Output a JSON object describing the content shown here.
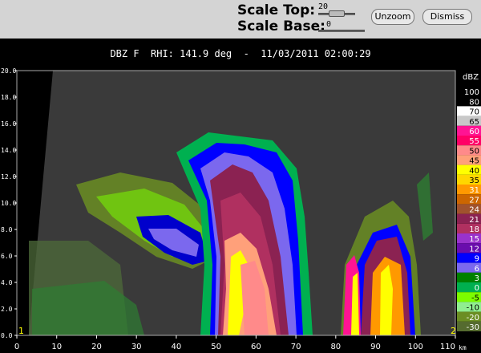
{
  "toolbar": {
    "scale_top_label": "Scale Top:",
    "scale_top_value": "20",
    "scale_base_label": "Scale Base:",
    "scale_base_value": "0",
    "unzoom_label": "Unzoom",
    "dismiss_label": "Dismiss"
  },
  "plot_title": "DBZ F  RHI: 141.9 deg  -  11/03/2011 02:00:29",
  "chart_data": {
    "type": "heatmap",
    "field": "DBZ F",
    "rhi_azimuth": "141.9 deg",
    "timestamp": "11/03/2011 02:00:29",
    "x_unit": "km",
    "xlim": [
      0,
      110
    ],
    "ylim": [
      0,
      20
    ],
    "x_ticks": [
      "0",
      "10",
      "20",
      "30",
      "40",
      "50",
      "60",
      "70",
      "80",
      "90",
      "100",
      "110"
    ],
    "y_ticks": [
      "0.0",
      "2.0",
      "4.0",
      "6.0",
      "8.0",
      "10.0",
      "12.0",
      "14.0",
      "16.0",
      "18.0",
      "20.0"
    ],
    "corner_markers": [
      "1",
      "2"
    ],
    "colorbar": {
      "unit": "dBZ",
      "levels": [
        "100",
        "80",
        "70",
        "65",
        "60",
        "55",
        "50",
        "45",
        "40",
        "35",
        "31",
        "27",
        "24",
        "21",
        "18",
        "15",
        "12",
        "9",
        "6",
        "3",
        "0",
        "-5",
        "-10",
        "-20",
        "-30"
      ],
      "colors": [
        "#000000",
        "#000000",
        "#ffffff",
        "#c8c8c8",
        "#ff1493",
        "#ff0066",
        "#ff8a8a",
        "#ffa07a",
        "#ffff00",
        "#ffd700",
        "#ff9900",
        "#cc6600",
        "#a0522d",
        "#8b2252",
        "#b03060",
        "#9932cc",
        "#6a0dad",
        "#0000ff",
        "#7b68ee",
        "#008000",
        "#00b050",
        "#7cfc00",
        "#90ee90",
        "#6b8e23",
        "#556b2f"
      ]
    }
  }
}
